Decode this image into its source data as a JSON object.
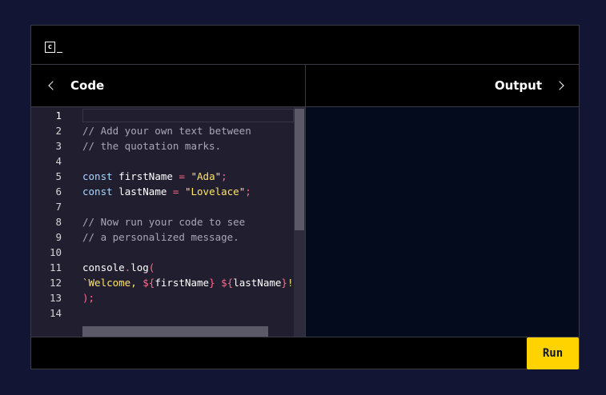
{
  "logo": {
    "text": "c",
    "icon": "codecademy-logo-icon"
  },
  "code_panel": {
    "title": "Code",
    "back_icon": "chevron-left-icon"
  },
  "output_panel": {
    "title": "Output",
    "forward_icon": "chevron-right-icon"
  },
  "editor": {
    "active_line": 1,
    "lines": [
      {
        "n": "1",
        "tokens": []
      },
      {
        "n": "2",
        "tokens": [
          {
            "t": "// Add your own text between",
            "c": "comment"
          }
        ]
      },
      {
        "n": "3",
        "tokens": [
          {
            "t": "// the quotation marks.",
            "c": "comment"
          }
        ]
      },
      {
        "n": "4",
        "tokens": []
      },
      {
        "n": "5",
        "tokens": [
          {
            "t": "const",
            "c": "kw"
          },
          {
            "t": " firstName ",
            "c": "id"
          },
          {
            "t": "=",
            "c": "op"
          },
          {
            "t": " ",
            "c": "id"
          },
          {
            "t": "\"Ada\"",
            "c": "str"
          },
          {
            "t": ";",
            "c": "op"
          }
        ]
      },
      {
        "n": "6",
        "tokens": [
          {
            "t": "const",
            "c": "kw"
          },
          {
            "t": " lastName ",
            "c": "id"
          },
          {
            "t": "=",
            "c": "op"
          },
          {
            "t": " ",
            "c": "id"
          },
          {
            "t": "\"Lovelace\"",
            "c": "str"
          },
          {
            "t": ";",
            "c": "op"
          }
        ]
      },
      {
        "n": "7",
        "tokens": []
      },
      {
        "n": "8",
        "tokens": [
          {
            "t": "// Now run your code to see",
            "c": "comment"
          }
        ]
      },
      {
        "n": "9",
        "tokens": [
          {
            "t": "// a personalized message.",
            "c": "comment"
          }
        ]
      },
      {
        "n": "10",
        "tokens": []
      },
      {
        "n": "11",
        "tokens": [
          {
            "t": "console",
            "c": "id"
          },
          {
            "t": ".",
            "c": "op"
          },
          {
            "t": "log",
            "c": "id"
          },
          {
            "t": "(",
            "c": "op"
          }
        ]
      },
      {
        "n": "12",
        "tokens": [
          {
            "t": "`Welcome, ",
            "c": "str"
          },
          {
            "t": "${",
            "c": "tpl"
          },
          {
            "t": "firstName",
            "c": "id"
          },
          {
            "t": "}",
            "c": "tpl"
          },
          {
            "t": " ",
            "c": "str"
          },
          {
            "t": "${",
            "c": "tpl"
          },
          {
            "t": "lastName",
            "c": "id"
          },
          {
            "t": "}",
            "c": "tpl"
          },
          {
            "t": "!`",
            "c": "str"
          }
        ]
      },
      {
        "n": "13",
        "tokens": [
          {
            "t": ");",
            "c": "op"
          }
        ]
      },
      {
        "n": "14",
        "tokens": []
      }
    ]
  },
  "run_button": {
    "label": "Run"
  },
  "colors": {
    "background": "#121634",
    "editor_bg": "#211e2f",
    "output_bg": "#030b1c",
    "run_button": "#ffd300",
    "string": "#ffe36b",
    "keyword": "#a9d6ff",
    "operator": "#ff6b8a",
    "comment": "#a9a6b8"
  }
}
